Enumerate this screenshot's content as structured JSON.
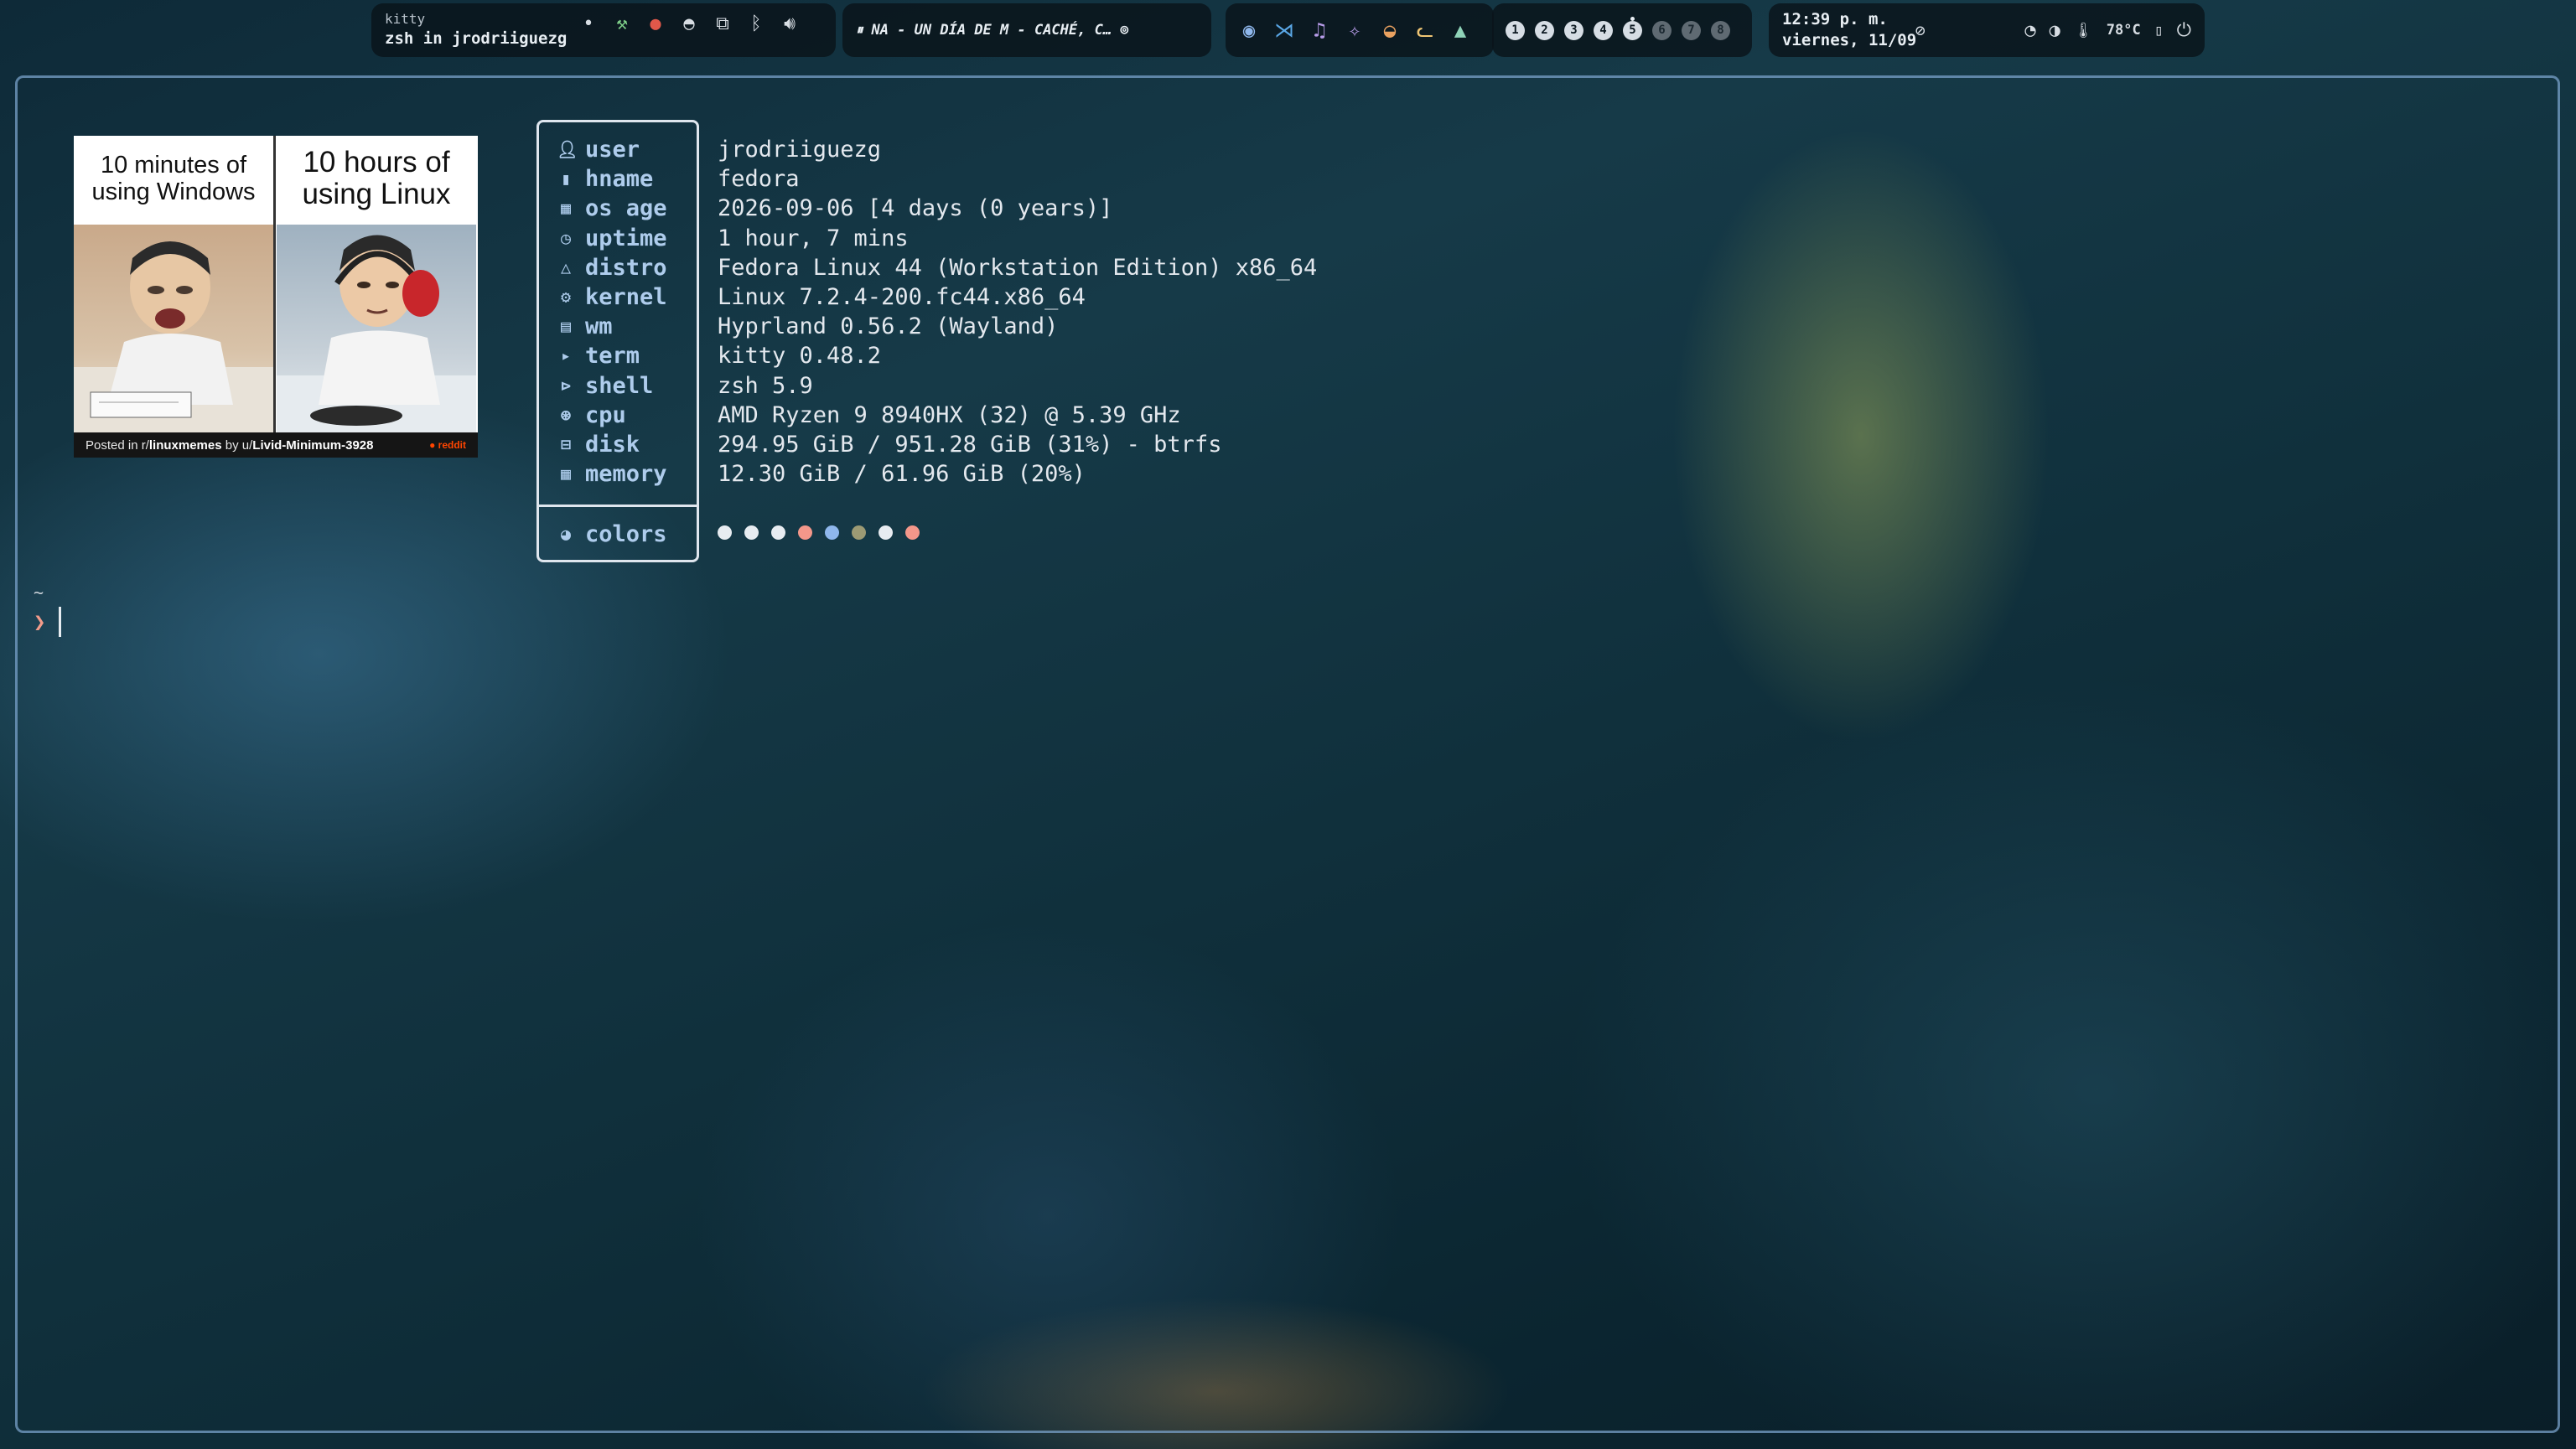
{
  "topbar": {
    "window_class": "kitty",
    "window_title": "zsh in jrodriiguezg",
    "tray_icons": [
      "dot-icon",
      "tool-icon",
      "tomato-icon",
      "arch-icon",
      "display-icon",
      "bluetooth-icon",
      "volume-icon"
    ],
    "media": {
      "status_glyph": "⏸",
      "title": "NA - UN DÍA DE M - CACHÉ, C…"
    },
    "apps": [
      "chrome-icon",
      "vscode-icon",
      "music-icon",
      "sparkle-app-icon",
      "cat-app-icon",
      "fox-app-icon",
      "android-icon"
    ],
    "workspaces": [
      {
        "label": "1",
        "state": "occupied"
      },
      {
        "label": "2",
        "state": "occupied"
      },
      {
        "label": "3",
        "state": "occupied"
      },
      {
        "label": "4",
        "state": "occupied"
      },
      {
        "label": "5",
        "state": "active"
      },
      {
        "label": "6",
        "state": "empty"
      },
      {
        "label": "7",
        "state": "empty"
      },
      {
        "label": "8",
        "state": "empty"
      }
    ],
    "clock": {
      "time": "12:39 p. m.",
      "date": "viernes, 11/09"
    },
    "temperature": "78°C"
  },
  "meme": {
    "caption_left": "10 minutes of using Windows",
    "caption_right": "10 hours of using Linux",
    "footer_prefix": "Posted in r/",
    "footer_sub": "linuxmemes",
    "footer_by": " by u/",
    "footer_user": "Livid-Minimum-3928",
    "footer_brand": "reddit"
  },
  "fastfetch": {
    "rows": [
      {
        "key": "user",
        "icon": "user-icon",
        "value": "jrodriiguezg"
      },
      {
        "key": "hname",
        "icon": "host-icon",
        "value": "fedora"
      },
      {
        "key": "os age",
        "icon": "calendar-icon",
        "value": "2026-09-06 [4 days (0 years)]"
      },
      {
        "key": "uptime",
        "icon": "clock-icon",
        "value": "1 hour, 7 mins"
      },
      {
        "key": "distro",
        "icon": "linux-icon",
        "value": "Fedora Linux 44 (Workstation Edition) x86_64"
      },
      {
        "key": "kernel",
        "icon": "gear-icon",
        "value": "Linux 7.2.4-200.fc44.x86_64"
      },
      {
        "key": "wm",
        "icon": "keyboard-icon",
        "value": "Hyprland 0.56.2 (Wayland)"
      },
      {
        "key": "term",
        "icon": "terminal-icon",
        "value": "kitty 0.48.2"
      },
      {
        "key": "shell",
        "icon": "shell-icon",
        "value": "zsh 5.9"
      },
      {
        "key": "cpu",
        "icon": "cpu-icon",
        "value": "AMD Ryzen 9 8940HX (32) @ 5.39 GHz"
      },
      {
        "key": "disk",
        "icon": "disk-icon",
        "value": "294.95 GiB / 951.28 GiB (31%) - btrfs"
      },
      {
        "key": "memory",
        "icon": "memory-icon",
        "value": "12.30 GiB / 61.96 GiB (20%)"
      }
    ],
    "colors_label": "colors",
    "palette": [
      "#e7ecf1",
      "#e7ecf1",
      "#e7ecf1",
      "#f3978a",
      "#8fb7ec",
      "#9c9a74",
      "#e7ecf1",
      "#f3978a"
    ]
  },
  "prompt": {
    "dir": "~",
    "symbol": "❯"
  }
}
